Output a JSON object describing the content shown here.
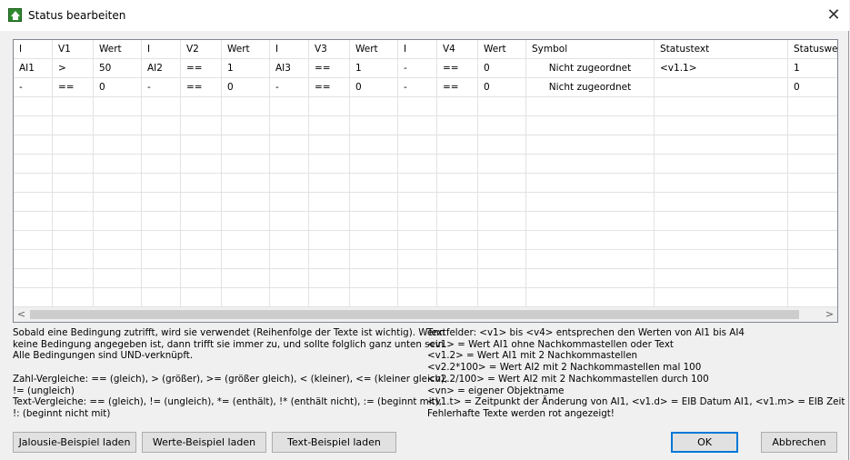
{
  "window": {
    "title": "Status bearbeiten",
    "close_glyph": "✕"
  },
  "grid": {
    "columns": [
      "I",
      "V1",
      "Wert",
      "I",
      "V2",
      "Wert",
      "I",
      "V3",
      "Wert",
      "I",
      "V4",
      "Wert",
      "Symbol",
      "Statustext",
      "Statuswe"
    ],
    "rows": [
      [
        "AI1",
        ">",
        "50",
        "AI2",
        "==",
        "1",
        "AI3",
        "==",
        "1",
        "-",
        "==",
        "0",
        "Nicht zugeordnet",
        "<v1.1>",
        "1"
      ],
      [
        "-",
        "==",
        "0",
        "-",
        "==",
        "0",
        "-",
        "==",
        "0",
        "-",
        "==",
        "0",
        "Nicht zugeordnet",
        "",
        "0"
      ]
    ],
    "scroll_left": "<",
    "scroll_right": ">"
  },
  "help_left": [
    "Sobald eine Bedingung zutrifft, wird sie verwendet (Reihenfolge der Texte ist wichtig). Wenn",
    "keine Bedingung angegeben ist, dann trifft sie immer zu, und sollte folglich ganz unten sein.",
    "Alle Bedingungen sind UND-verknüpft.",
    "",
    "Zahl-Vergleiche: == (gleich), > (größer), >= (größer gleich), < (kleiner), <= (kleiner gleich),",
    "!= (ungleich)",
    "Text-Vergleiche: == (gleich), != (ungleich), *= (enthält), !* (enthält nicht), := (beginnt mit),",
    "!: (beginnt nicht mit)"
  ],
  "help_right": [
    "Textfelder: <v1> bis <v4> entsprechen den Werten von AI1 bis AI4",
    "<v1> = Wert AI1 ohne Nachkommastellen oder Text",
    "<v1.2> = Wert AI1 mit 2 Nachkommastellen",
    "<v2.2*100> = Wert AI2 mit 2 Nachkommastellen mal 100",
    "<v2.2/100> = Wert AI2 mit 2 Nachkommastellen durch 100",
    "<vn> = eigener Objektname",
    "<v1.t> = Zeitpunkt der Änderung von AI1, <v1.d> = EIB Datum AI1, <v1.m> = EIB Zeit",
    "Fehlerhafte Texte werden rot angezeigt!"
  ],
  "buttons": {
    "jalousie": "Jalousie-Beispiel laden",
    "werte": "Werte-Beispiel laden",
    "text": "Text-Beispiel laden",
    "ok": "OK",
    "cancel": "Abbrechen"
  }
}
